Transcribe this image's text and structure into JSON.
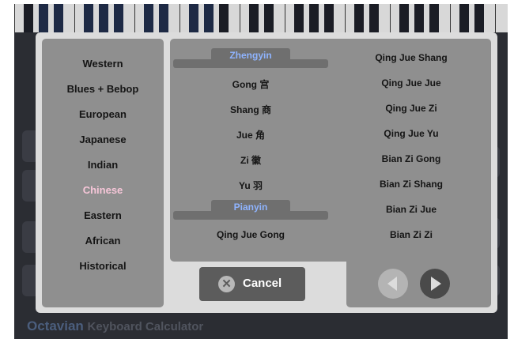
{
  "app": {
    "name": "Octavian",
    "subtitle": "Keyboard Calculator"
  },
  "sidebar": {
    "active": "Chinese",
    "items": [
      "Western",
      "Blues + Bebop",
      "European",
      "Japanese",
      "Indian",
      "Chinese",
      "Eastern",
      "African",
      "Historical"
    ]
  },
  "scales": {
    "section_1": "Zhengyin",
    "section_2": "Pianyin",
    "left": [
      "Gong 宫",
      "Shang 商",
      "Jue 角",
      "Zi 徽",
      "Yu 羽",
      "Qing Jue Gong"
    ],
    "right": [
      "Qing Jue Shang",
      "Qing Jue Jue",
      "Qing Jue Zi",
      "Qing Jue Yu",
      "Bian Zi Gong",
      "Bian Zi Shang",
      "Bian Zi Jue",
      "Bian Zi Zi"
    ]
  },
  "buttons": {
    "cancel": "Cancel",
    "cancel_icon": "close-icon",
    "prev_icon": "arrow-left-icon",
    "next_icon": "arrow-right-icon"
  },
  "colors": {
    "active_item": "#f6c6d8",
    "section_header": "#8fb4ff",
    "panel": "#8f8f8f",
    "dialog": "#dcdcdc"
  }
}
